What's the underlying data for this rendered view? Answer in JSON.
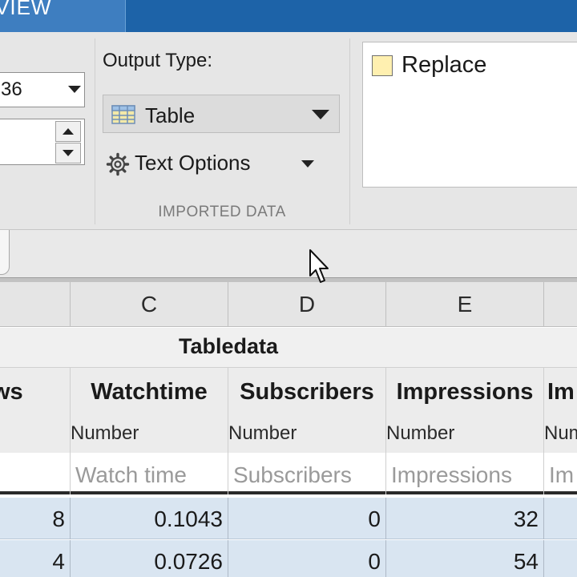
{
  "ribbon": {
    "tab_label": "VIEW",
    "delimiter_combo_value": "36",
    "output_type_label": "Output Type:",
    "output_type_value": "Table",
    "text_options_label": "Text Options",
    "group_title": "IMPORTED DATA",
    "replace_label": "Replace",
    "replace_color": "#fff0b0"
  },
  "sheet": {
    "column_letters": [
      "C",
      "D",
      "E"
    ],
    "table_title": "Tabledata",
    "variables": [
      {
        "name": "ws",
        "type": "",
        "description": ""
      },
      {
        "name": "Watchtime",
        "type": "Number",
        "description": "Watch time"
      },
      {
        "name": "Subscribers",
        "type": "Number",
        "description": "Subscribers"
      },
      {
        "name": "Impressions",
        "type": "Number",
        "description": "Impressions"
      },
      {
        "name": "Im",
        "type": "Num",
        "description": "Im"
      }
    ],
    "rows": [
      [
        "8",
        "0.1043",
        "0",
        "32"
      ],
      [
        "4",
        "0.0726",
        "0",
        "54"
      ]
    ],
    "selection_color": "#d9e5f1"
  },
  "icons": [
    "table-icon",
    "gear-icon",
    "dropdown-arrow-icon",
    "spinner-up-icon",
    "spinner-down-icon",
    "mouse-pointer-icon"
  ]
}
